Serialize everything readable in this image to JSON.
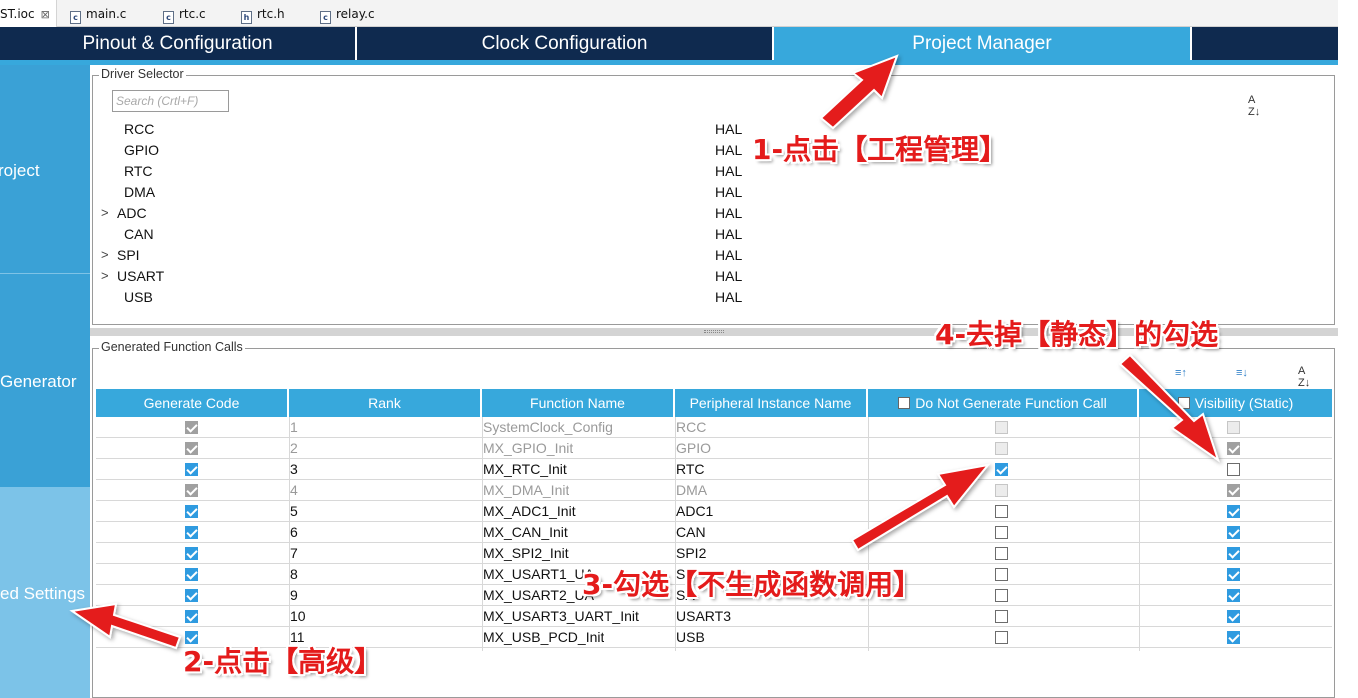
{
  "editor_tabs": [
    {
      "label": "ST.ioc",
      "close": "⊠",
      "icon": ""
    },
    {
      "label": "main.c",
      "icon": "c"
    },
    {
      "label": "rtc.c",
      "icon": "c"
    },
    {
      "label": "rtc.h",
      "icon": "h"
    },
    {
      "label": "relay.c",
      "icon": "c"
    }
  ],
  "main_tabs": [
    "Pinout & Configuration",
    "Clock Configuration",
    "Project Manager"
  ],
  "active_main_tab": "Project Manager",
  "side_nav": [
    "roject",
    "Generator",
    "ed Settings"
  ],
  "driver_selector": {
    "title": "Driver Selector",
    "search_placeholder": "Search (Crtl+F)",
    "sort_icon": "sort-az-icon",
    "rows": [
      {
        "name": "RCC",
        "driver": "HAL",
        "expander": ""
      },
      {
        "name": "GPIO",
        "driver": "HAL",
        "expander": ""
      },
      {
        "name": "RTC",
        "driver": "HAL",
        "expander": ""
      },
      {
        "name": "DMA",
        "driver": "HAL",
        "expander": ""
      },
      {
        "name": "ADC",
        "driver": "HAL",
        "expander": ">"
      },
      {
        "name": "CAN",
        "driver": "HAL",
        "expander": ""
      },
      {
        "name": "SPI",
        "driver": "HAL",
        "expander": ">"
      },
      {
        "name": "USART",
        "driver": "HAL",
        "expander": ">"
      },
      {
        "name": "USB",
        "driver": "HAL",
        "expander": ""
      }
    ]
  },
  "generated_calls": {
    "title": "Generated Function Calls",
    "toolbar_icons": [
      "move-up-icon",
      "move-down-icon",
      "sort-az-icon"
    ],
    "columns": [
      "Generate Code",
      "Rank",
      "Function Name",
      "Peripheral Instance Name",
      "Do Not Generate Function Call",
      "Visibility (Static)"
    ],
    "rows": [
      {
        "gen": "grey",
        "rank": "1",
        "fn": "SystemClock_Config",
        "inst": "RCC",
        "nogen": "dis",
        "vis": "dis",
        "dim": true
      },
      {
        "gen": "grey",
        "rank": "2",
        "fn": "MX_GPIO_Init",
        "inst": "GPIO",
        "nogen": "dis",
        "vis": "grey",
        "dim": true
      },
      {
        "gen": "on",
        "rank": "3",
        "fn": "MX_RTC_Init",
        "inst": "RTC",
        "nogen": "on",
        "vis": "off",
        "dim": false
      },
      {
        "gen": "grey",
        "rank": "4",
        "fn": "MX_DMA_Init",
        "inst": "DMA",
        "nogen": "dis",
        "vis": "grey",
        "dim": true
      },
      {
        "gen": "on",
        "rank": "5",
        "fn": "MX_ADC1_Init",
        "inst": "ADC1",
        "nogen": "off",
        "vis": "on",
        "dim": false
      },
      {
        "gen": "on",
        "rank": "6",
        "fn": "MX_CAN_Init",
        "inst": "CAN",
        "nogen": "off",
        "vis": "on",
        "dim": false
      },
      {
        "gen": "on",
        "rank": "7",
        "fn": "MX_SPI2_Init",
        "inst": "SPI2",
        "nogen": "off",
        "vis": "on",
        "dim": false
      },
      {
        "gen": "on",
        "rank": "8",
        "fn": "MX_USART1_UA",
        "inst": "SA",
        "nogen": "off",
        "vis": "on",
        "dim": false
      },
      {
        "gen": "on",
        "rank": "9",
        "fn": "MX_USART2_UA",
        "inst": "SA",
        "nogen": "off",
        "vis": "on",
        "dim": false
      },
      {
        "gen": "on",
        "rank": "10",
        "fn": "MX_USART3_UART_Init",
        "inst": "USART3",
        "nogen": "off",
        "vis": "on",
        "dim": false
      },
      {
        "gen": "on",
        "rank": "11",
        "fn": "MX_USB_PCD_Init",
        "inst": "USB",
        "nogen": "off",
        "vis": "on",
        "dim": false
      }
    ]
  },
  "annotations": {
    "step1": "1-点击【工程管理】",
    "step2": "2-点击【高级】",
    "step3": "3-勾选【不生成函数调用】",
    "step4": "4-去掉【静态】的勾选"
  },
  "colors": {
    "nav_dark": "#0f2a4f",
    "accent": "#37a8dc",
    "annotation": "#e41b1b",
    "checkbox": "#2f9be0"
  }
}
